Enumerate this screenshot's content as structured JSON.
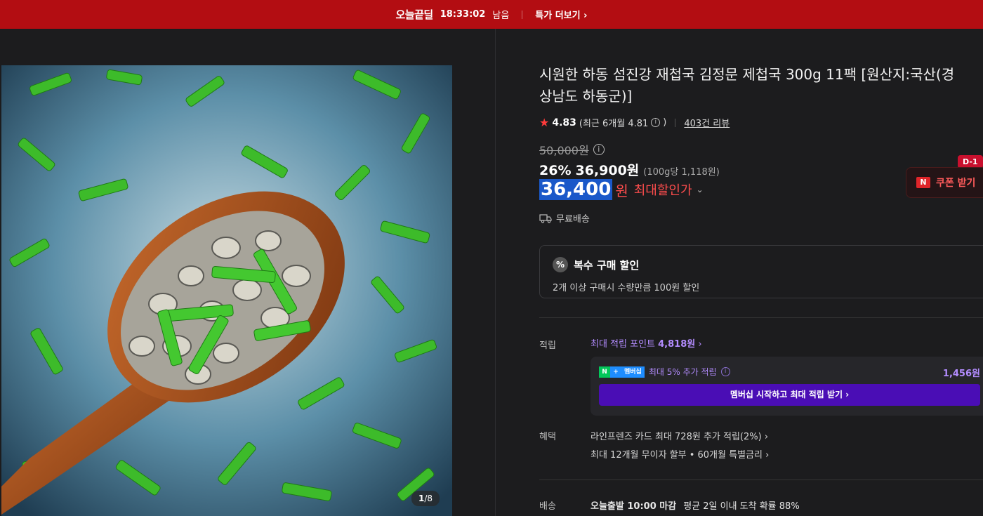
{
  "topbar": {
    "logo": "오늘끝딜",
    "timer": "18:33:02",
    "remaining": "남음",
    "more": "특가 더보기 ›"
  },
  "gallery": {
    "counter_current": "1",
    "counter_total": "/8"
  },
  "product": {
    "title": "시원한 하동 섬진강 재첩국 김정문 제첩국 300g 11팩 [원산지:국산(경상남도 하동군)]",
    "rating": "4.83",
    "recent_rating": "(최근 6개월 4.81",
    "recent_close": ")",
    "reviews": "403건 리뷰",
    "original_price": "50,000원",
    "discount_pct": "26%",
    "sale_price": "36,900원",
    "unit_price": "(100g당 1,118원)",
    "max_price": "36,400",
    "max_won": "원",
    "max_label": "최대할인가",
    "shipping": "무료배송"
  },
  "coupon": {
    "badge": "D-1",
    "label": "쿠폰 받기",
    "icon": "N"
  },
  "multi_discount": {
    "title": "복수 구매 할인",
    "desc": "2개 이상 구매시 수량만큼 100원 할인",
    "icon": "%"
  },
  "points": {
    "label": "적립",
    "link_prefix": "최대 적립 포인트 ",
    "link_amount": "4,818원",
    "link_chev": "›",
    "member_badge_n": "N",
    "member_badge_plus": "+",
    "member_badge_text": "멤버십",
    "member_text": "최대 5% 추가 적립",
    "member_amount": "1,456원",
    "member_button": "멤버십 시작하고 최대 적립 받기 ›"
  },
  "benefits": {
    "label": "혜택",
    "line1": "라인프렌즈 카드 최대 728원 추가 적립(2%) ›",
    "line2": "최대 12개월 무이자 할부 • 60개월 특별금리 ›"
  },
  "delivery": {
    "label": "배송",
    "dispatch": "오늘출발 10:00 마감",
    "arrival": "평균 2일 이내 도착 확률 88%"
  },
  "colors": {
    "topbar": "#b30d12",
    "accent_red": "#ff4d4d",
    "highlight": "#1a58c9",
    "membership_purple": "#4a0db5",
    "point_purple": "#b38cff"
  }
}
